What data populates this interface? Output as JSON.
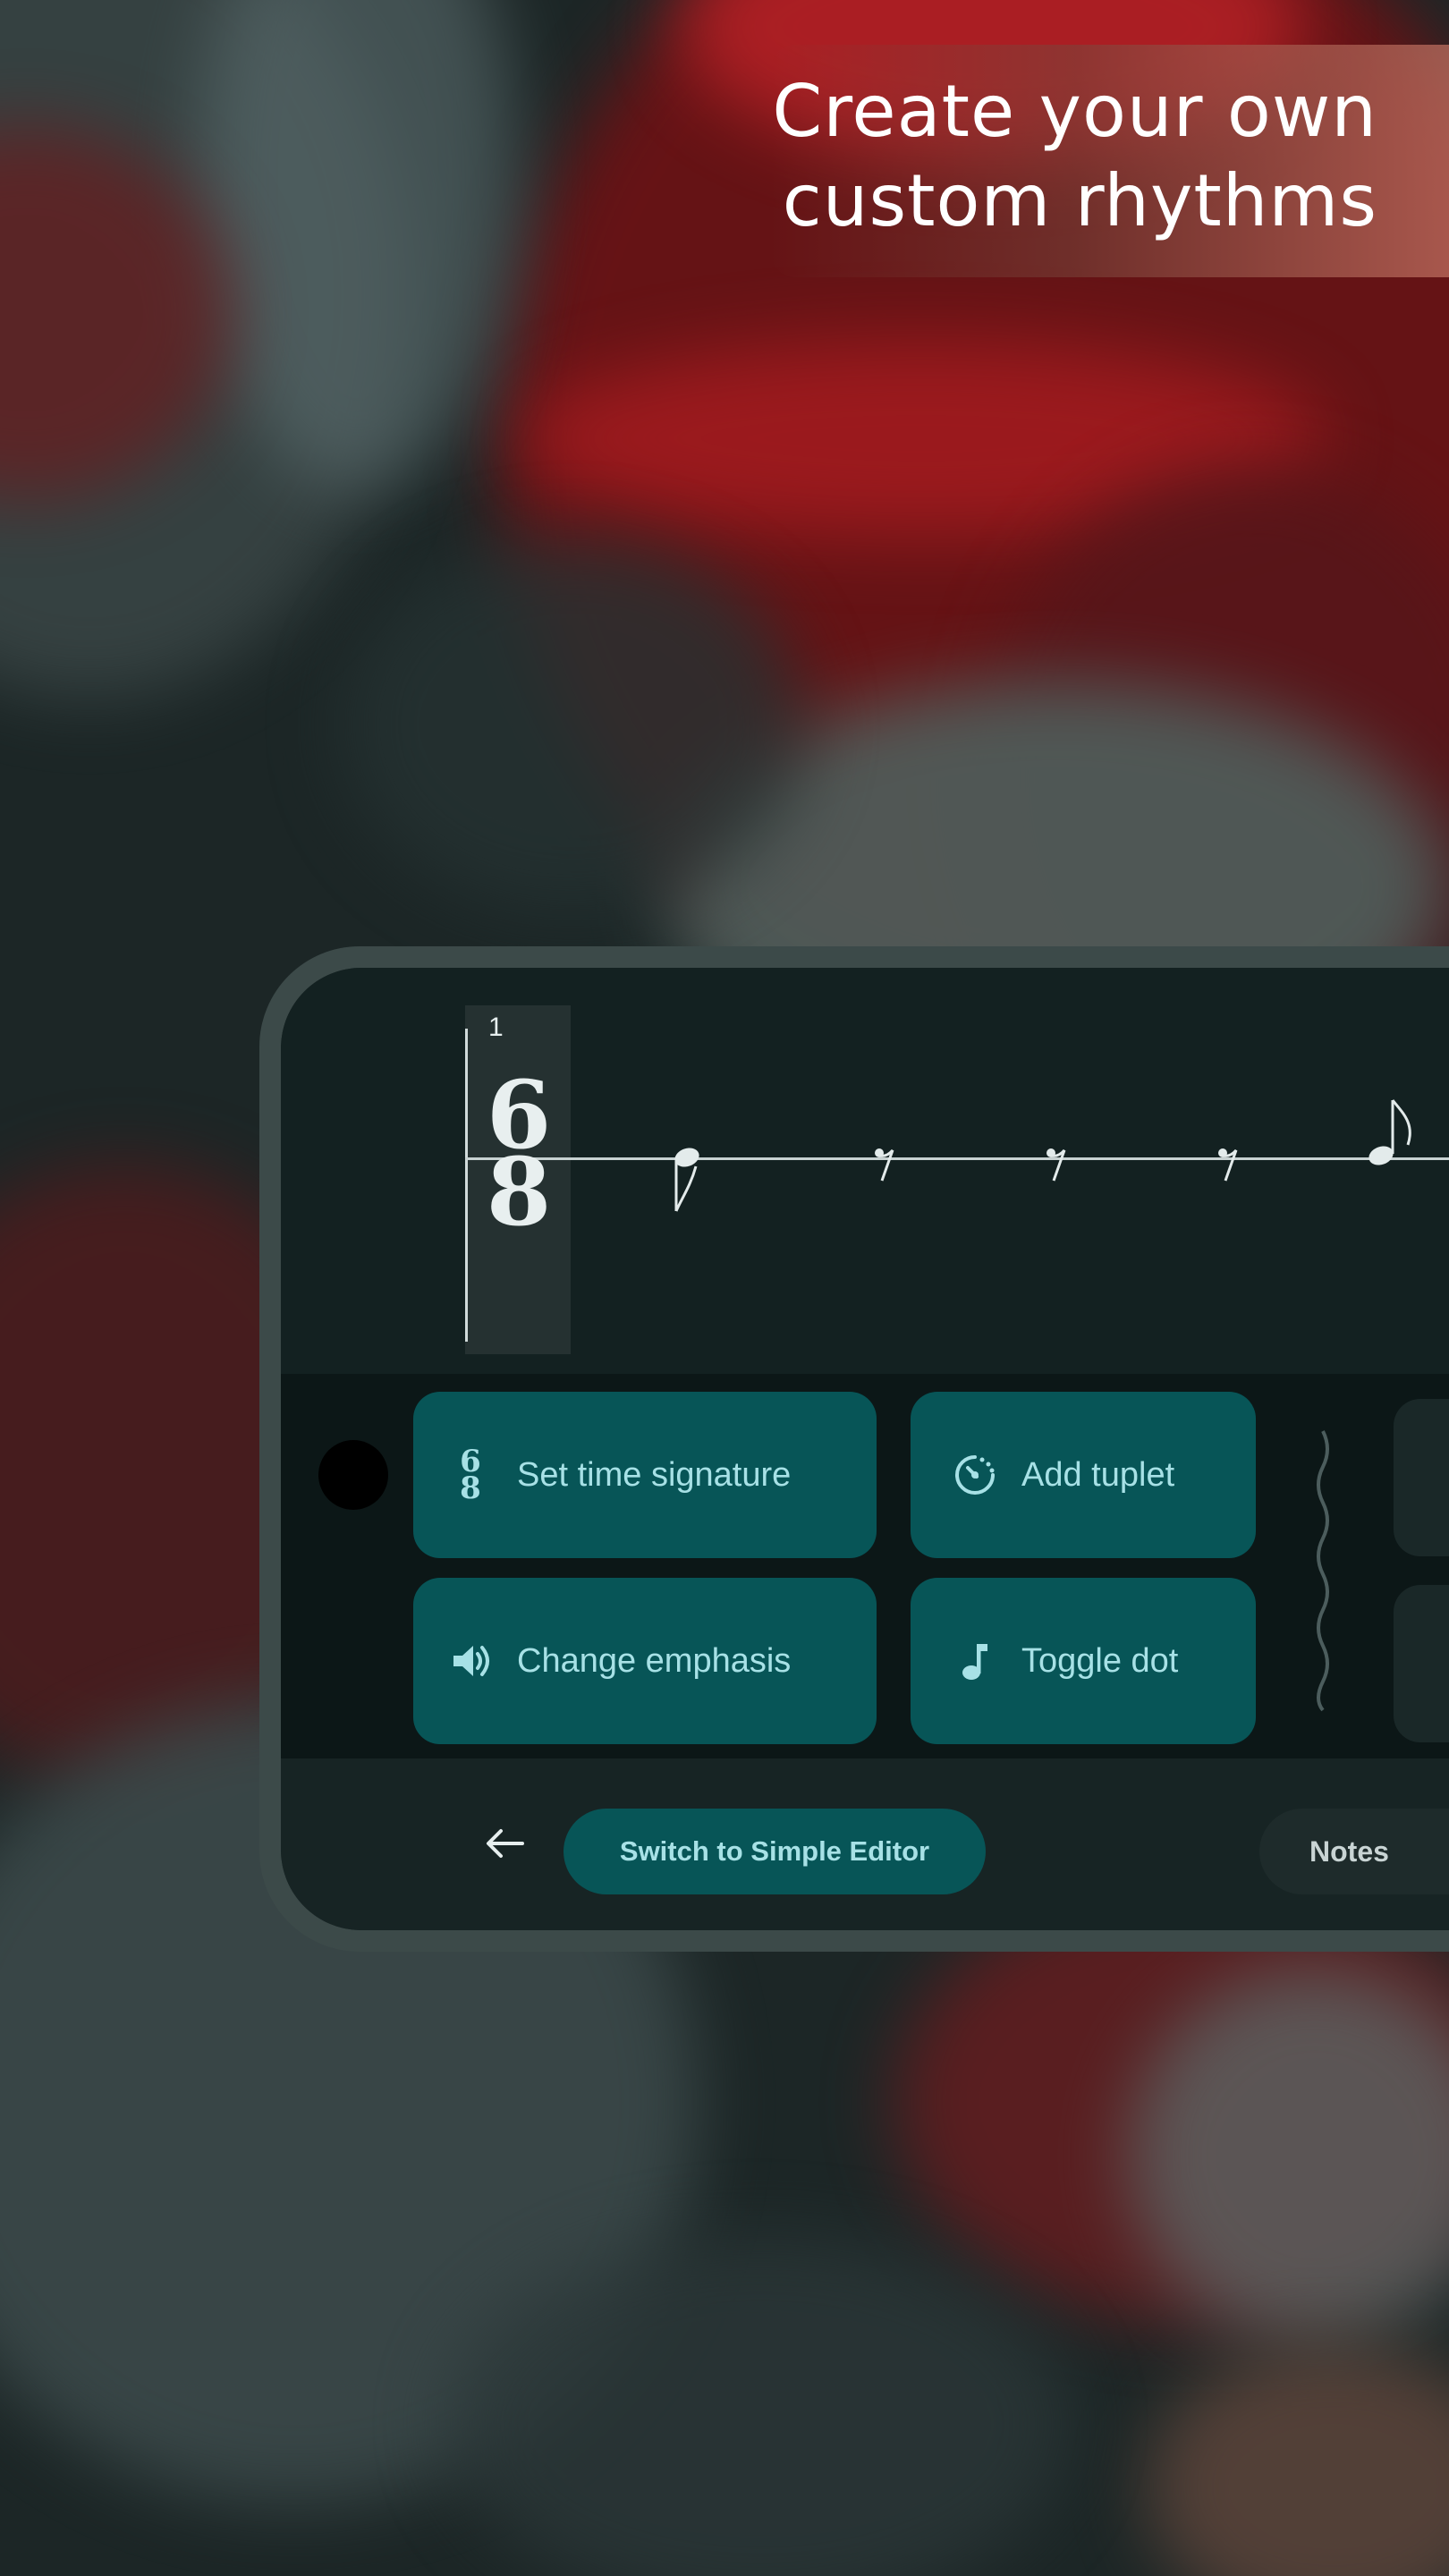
{
  "headline": {
    "line1": "Create your own",
    "line2": "custom rhythms"
  },
  "editor": {
    "measure_number": "1",
    "time_signature": {
      "numerator": "6",
      "denominator": "8"
    }
  },
  "toolbar": {
    "set_time_signature": {
      "label": "Set time signature",
      "icon": "time-signature-icon",
      "icon_top": "6",
      "icon_bottom": "8"
    },
    "add_tuplet": {
      "label": "Add tuplet",
      "icon": "tuplet-timer-icon"
    },
    "change_emphasis": {
      "label": "Change emphasis",
      "icon": "speaker-volume-icon"
    },
    "toggle_dot": {
      "label": "Toggle dot",
      "icon": "music-note-icon"
    }
  },
  "bottom_bar": {
    "back_icon": "arrow-back-icon",
    "switch_label": "Switch to Simple Editor",
    "notes_label": "Notes"
  },
  "colors": {
    "accent": "#075557",
    "accent_text": "#a7e1e6",
    "screen_bg": "#111d1d",
    "phone_frame": "#3c4a49"
  }
}
